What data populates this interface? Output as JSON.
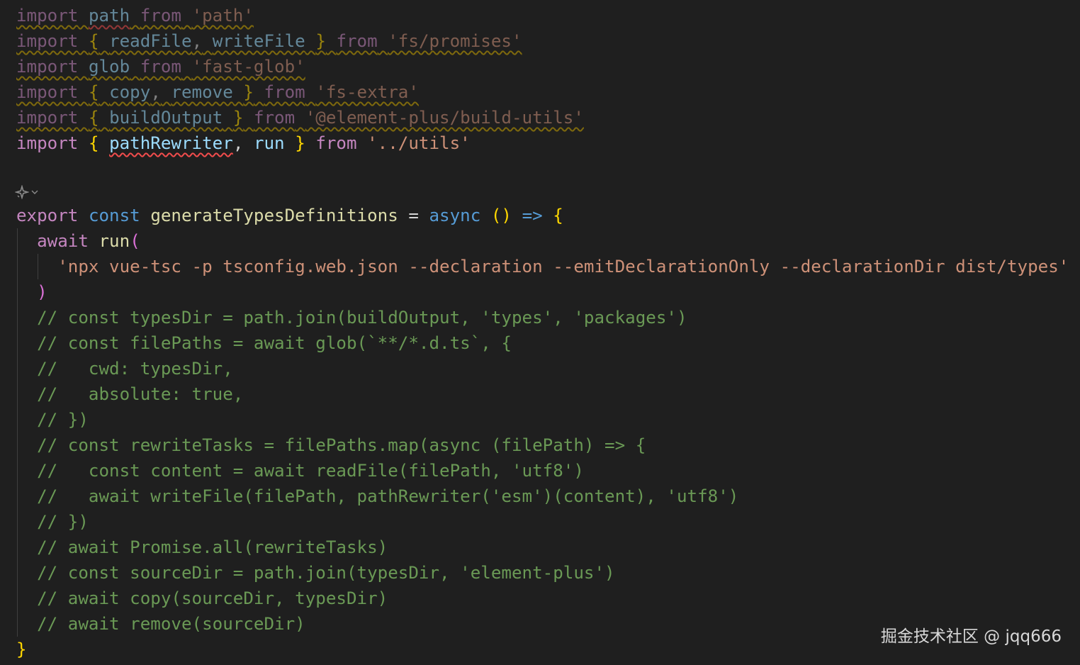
{
  "watermark": "掘金技术社区 @ jqq666",
  "codelens": {
    "sparkle_icon": "sparkle-icon",
    "chevron_icon": "chevron-down-icon"
  },
  "colors": {
    "background": "#1f1f1f",
    "keyword": "#c586c0",
    "variable": "#9cdcfe",
    "function": "#dcdcaa",
    "string": "#ce9178",
    "storage": "#569cd6",
    "comment": "#6a9955",
    "bracket_level_1": "#ffd700",
    "bracket_level_2": "#da70d6",
    "warning_squiggle": "#cca700",
    "error_squiggle": "#f14c4c"
  },
  "code_lines": [
    {
      "dim": true,
      "tokens": [
        {
          "t": "import",
          "c": "kw",
          "sq": "warn"
        },
        {
          "t": " ",
          "c": "plain",
          "sq": "warn"
        },
        {
          "t": "path",
          "c": "id",
          "sq": "err"
        },
        {
          "t": " ",
          "c": "plain",
          "sq": "warn"
        },
        {
          "t": "from",
          "c": "kw",
          "sq": "warn"
        },
        {
          "t": " ",
          "c": "plain",
          "sq": "warn"
        },
        {
          "t": "'path'",
          "c": "str",
          "sq": "warn"
        }
      ]
    },
    {
      "dim": true,
      "tokens": [
        {
          "t": "import",
          "c": "kw",
          "sq": "warn"
        },
        {
          "t": " ",
          "c": "plain",
          "sq": "warn"
        },
        {
          "t": "{",
          "c": "brc",
          "sq": "warn"
        },
        {
          "t": " ",
          "c": "plain",
          "sq": "warn"
        },
        {
          "t": "readFile",
          "c": "id",
          "sq": "warn"
        },
        {
          "t": ",",
          "c": "pun",
          "sq": "warn"
        },
        {
          "t": " ",
          "c": "plain",
          "sq": "warn"
        },
        {
          "t": "writeFile",
          "c": "id",
          "sq": "warn"
        },
        {
          "t": " ",
          "c": "plain",
          "sq": "warn"
        },
        {
          "t": "}",
          "c": "brc",
          "sq": "warn"
        },
        {
          "t": " ",
          "c": "plain",
          "sq": "warn"
        },
        {
          "t": "from",
          "c": "kw",
          "sq": "warn"
        },
        {
          "t": " ",
          "c": "plain",
          "sq": "warn"
        },
        {
          "t": "'fs/promises'",
          "c": "str",
          "sq": "warn"
        }
      ]
    },
    {
      "dim": true,
      "tokens": [
        {
          "t": "import",
          "c": "kw",
          "sq": "warn"
        },
        {
          "t": " ",
          "c": "plain",
          "sq": "warn"
        },
        {
          "t": "glob",
          "c": "id",
          "sq": "warn"
        },
        {
          "t": " ",
          "c": "plain",
          "sq": "warn"
        },
        {
          "t": "from",
          "c": "kw",
          "sq": "warn"
        },
        {
          "t": " ",
          "c": "plain",
          "sq": "warn"
        },
        {
          "t": "'fast-glob'",
          "c": "str",
          "sq": "warn"
        }
      ]
    },
    {
      "dim": true,
      "tokens": [
        {
          "t": "import",
          "c": "kw",
          "sq": "warn"
        },
        {
          "t": " ",
          "c": "plain",
          "sq": "warn"
        },
        {
          "t": "{",
          "c": "brc",
          "sq": "warn"
        },
        {
          "t": " ",
          "c": "plain",
          "sq": "warn"
        },
        {
          "t": "copy",
          "c": "id",
          "sq": "warn"
        },
        {
          "t": ",",
          "c": "pun",
          "sq": "warn"
        },
        {
          "t": " ",
          "c": "plain",
          "sq": "warn"
        },
        {
          "t": "remove",
          "c": "id",
          "sq": "warn"
        },
        {
          "t": " ",
          "c": "plain",
          "sq": "warn"
        },
        {
          "t": "}",
          "c": "brc",
          "sq": "warn"
        },
        {
          "t": " ",
          "c": "plain",
          "sq": "warn"
        },
        {
          "t": "from",
          "c": "kw",
          "sq": "warn"
        },
        {
          "t": " ",
          "c": "plain",
          "sq": "warn"
        },
        {
          "t": "'fs-extra'",
          "c": "str",
          "sq": "warn"
        }
      ]
    },
    {
      "dim": true,
      "tokens": [
        {
          "t": "import",
          "c": "kw",
          "sq": "warn"
        },
        {
          "t": " ",
          "c": "plain",
          "sq": "warn"
        },
        {
          "t": "{",
          "c": "brc",
          "sq": "warn"
        },
        {
          "t": " ",
          "c": "plain",
          "sq": "warn"
        },
        {
          "t": "buildOutput",
          "c": "id",
          "sq": "warn"
        },
        {
          "t": " ",
          "c": "plain",
          "sq": "warn"
        },
        {
          "t": "}",
          "c": "brc",
          "sq": "warn"
        },
        {
          "t": " ",
          "c": "plain",
          "sq": "warn"
        },
        {
          "t": "from",
          "c": "kw",
          "sq": "warn"
        },
        {
          "t": " ",
          "c": "plain",
          "sq": "warn"
        },
        {
          "t": "'@element-plus/build-utils'",
          "c": "str",
          "sq": "warn"
        }
      ]
    },
    {
      "dim": false,
      "tokens": [
        {
          "t": "import",
          "c": "kw"
        },
        {
          "t": " ",
          "c": "plain"
        },
        {
          "t": "{",
          "c": "brc"
        },
        {
          "t": " ",
          "c": "plain"
        },
        {
          "t": "pathRewriter",
          "c": "id",
          "sq": "err"
        },
        {
          "t": ",",
          "c": "pun"
        },
        {
          "t": " ",
          "c": "plain"
        },
        {
          "t": "run",
          "c": "id"
        },
        {
          "t": " ",
          "c": "plain"
        },
        {
          "t": "}",
          "c": "brc"
        },
        {
          "t": " ",
          "c": "plain"
        },
        {
          "t": "from",
          "c": "kw"
        },
        {
          "t": " ",
          "c": "plain"
        },
        {
          "t": "'../utils'",
          "c": "str"
        }
      ]
    },
    {
      "tokens": [
        {
          "t": "export",
          "c": "kw"
        },
        {
          "t": " ",
          "c": "plain"
        },
        {
          "t": "const",
          "c": "sto"
        },
        {
          "t": " ",
          "c": "plain"
        },
        {
          "t": "generateTypesDefinitions",
          "c": "fn"
        },
        {
          "t": " = ",
          "c": "pun"
        },
        {
          "t": "async",
          "c": "sto"
        },
        {
          "t": " ",
          "c": "plain"
        },
        {
          "t": "()",
          "c": "brc"
        },
        {
          "t": " ",
          "c": "plain"
        },
        {
          "t": "=>",
          "c": "sto"
        },
        {
          "t": " ",
          "c": "plain"
        },
        {
          "t": "{",
          "c": "brc"
        }
      ]
    },
    {
      "tokens": [
        {
          "t": "  ",
          "c": "plain"
        },
        {
          "t": "await",
          "c": "kw"
        },
        {
          "t": " ",
          "c": "plain"
        },
        {
          "t": "run",
          "c": "fn"
        },
        {
          "t": "(",
          "c": "brc2"
        }
      ]
    },
    {
      "tokens": [
        {
          "t": "    ",
          "c": "plain"
        },
        {
          "t": "'npx vue-tsc -p tsconfig.web.json --declaration --emitDeclarationOnly --declarationDir dist/types'",
          "c": "str"
        }
      ]
    },
    {
      "tokens": [
        {
          "t": "  ",
          "c": "plain"
        },
        {
          "t": ")",
          "c": "brc2"
        }
      ]
    },
    {
      "tokens": [
        {
          "t": "  // const typesDir = path.join(buildOutput, 'types', 'packages')",
          "c": "cmt"
        }
      ]
    },
    {
      "tokens": [
        {
          "t": "  // const filePaths = await glob(`**/*.d.ts`, {",
          "c": "cmt"
        }
      ]
    },
    {
      "tokens": [
        {
          "t": "  //   cwd: typesDir,",
          "c": "cmt"
        }
      ]
    },
    {
      "tokens": [
        {
          "t": "  //   absolute: true,",
          "c": "cmt"
        }
      ]
    },
    {
      "tokens": [
        {
          "t": "  // })",
          "c": "cmt"
        }
      ]
    },
    {
      "tokens": [
        {
          "t": "  // const rewriteTasks = filePaths.map(async (filePath) => {",
          "c": "cmt"
        }
      ]
    },
    {
      "tokens": [
        {
          "t": "  //   const content = await readFile(filePath, 'utf8')",
          "c": "cmt"
        }
      ]
    },
    {
      "tokens": [
        {
          "t": "  //   await writeFile(filePath, pathRewriter('esm')(content), 'utf8')",
          "c": "cmt"
        }
      ]
    },
    {
      "tokens": [
        {
          "t": "  // })",
          "c": "cmt"
        }
      ]
    },
    {
      "tokens": [
        {
          "t": "  // await Promise.all(rewriteTasks)",
          "c": "cmt"
        }
      ]
    },
    {
      "tokens": [
        {
          "t": "  // const sourceDir = path.join(typesDir, 'element-plus')",
          "c": "cmt"
        }
      ]
    },
    {
      "tokens": [
        {
          "t": "  // await copy(sourceDir, typesDir)",
          "c": "cmt"
        }
      ]
    },
    {
      "tokens": [
        {
          "t": "  // await remove(sourceDir)",
          "c": "cmt"
        }
      ]
    },
    {
      "tokens": [
        {
          "t": "}",
          "c": "brc"
        }
      ]
    }
  ]
}
